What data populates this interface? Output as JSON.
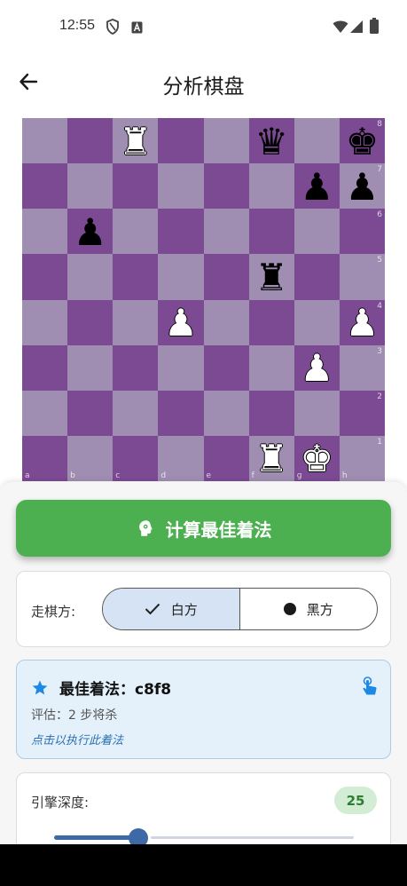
{
  "status_bar": {
    "time": "12:55",
    "icons": [
      "shield-icon",
      "a-badge-icon",
      "wifi-icon",
      "signal-icon",
      "battery-icon"
    ]
  },
  "app_bar": {
    "title": "分析棋盘",
    "back_icon": "arrow-back-icon"
  },
  "board": {
    "colors": {
      "light": "#9f8eb2",
      "dark": "#7c4a93"
    },
    "files": [
      "a",
      "b",
      "c",
      "d",
      "e",
      "f",
      "g",
      "h"
    ],
    "ranks": [
      "8",
      "7",
      "6",
      "5",
      "4",
      "3",
      "2",
      "1"
    ],
    "pieces": {
      "c8": "wR",
      "f8": "bQ",
      "h8": "bK",
      "g7": "bP",
      "h7": "bP",
      "b6": "bP",
      "f5": "bR",
      "d4": "wP",
      "h4": "wP",
      "g3": "wP",
      "f1": "wR",
      "g1": "wK"
    }
  },
  "calc_button": {
    "label": "计算最佳着法",
    "icon": "brain-head-icon",
    "color": "#4caf50"
  },
  "turn": {
    "label": "走棋方:",
    "options": [
      "白方",
      "黑方"
    ],
    "selected": "白方"
  },
  "best_move": {
    "title": "最佳着法：c8f8",
    "evaluation": "评估：2 步将杀",
    "hint": "点击以执行此着法",
    "icon": "star-icon",
    "action_icon": "touch-app-icon"
  },
  "depth": {
    "label": "引擎深度:",
    "value": "25",
    "slider_fraction": 0.28
  }
}
